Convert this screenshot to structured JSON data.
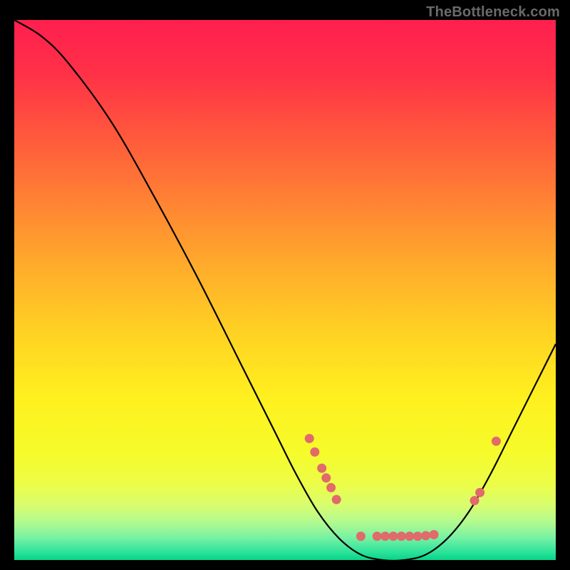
{
  "watermark": "TheBottleneck.com",
  "chart_data": {
    "type": "line",
    "title": "",
    "xlabel": "",
    "ylabel": "",
    "xlim": [
      0,
      100
    ],
    "ylim": [
      0,
      100
    ],
    "curve": [
      {
        "x": 0,
        "y": 100
      },
      {
        "x": 5,
        "y": 97
      },
      {
        "x": 10,
        "y": 92
      },
      {
        "x": 18,
        "y": 81
      },
      {
        "x": 26,
        "y": 67
      },
      {
        "x": 34,
        "y": 52
      },
      {
        "x": 42,
        "y": 36
      },
      {
        "x": 48,
        "y": 24
      },
      {
        "x": 52,
        "y": 16
      },
      {
        "x": 56,
        "y": 9
      },
      {
        "x": 60,
        "y": 4
      },
      {
        "x": 64,
        "y": 1
      },
      {
        "x": 68,
        "y": 0
      },
      {
        "x": 72,
        "y": 0
      },
      {
        "x": 76,
        "y": 1
      },
      {
        "x": 80,
        "y": 4
      },
      {
        "x": 84,
        "y": 9
      },
      {
        "x": 88,
        "y": 16
      },
      {
        "x": 92,
        "y": 24
      },
      {
        "x": 96,
        "y": 32
      },
      {
        "x": 100,
        "y": 40
      }
    ],
    "points": [
      {
        "x": 54.5,
        "y": 22.5
      },
      {
        "x": 55.5,
        "y": 20.0
      },
      {
        "x": 56.8,
        "y": 17.0
      },
      {
        "x": 57.6,
        "y": 15.2
      },
      {
        "x": 58.5,
        "y": 13.4
      },
      {
        "x": 59.5,
        "y": 11.2
      },
      {
        "x": 64.0,
        "y": 4.4
      },
      {
        "x": 67.0,
        "y": 4.4
      },
      {
        "x": 68.5,
        "y": 4.4
      },
      {
        "x": 70.0,
        "y": 4.4
      },
      {
        "x": 71.5,
        "y": 4.4
      },
      {
        "x": 73.0,
        "y": 4.4
      },
      {
        "x": 74.5,
        "y": 4.4
      },
      {
        "x": 76.0,
        "y": 4.5
      },
      {
        "x": 77.5,
        "y": 4.7
      },
      {
        "x": 85.0,
        "y": 11.0
      },
      {
        "x": 86.0,
        "y": 12.5
      },
      {
        "x": 89.0,
        "y": 22.0
      }
    ],
    "point_color": "#e16a6a",
    "point_radius": 6.5,
    "curve_color": "#000000",
    "gradient_stops": [
      {
        "offset": 0.0,
        "color": "#ff1f4f"
      },
      {
        "offset": 0.1,
        "color": "#ff3147"
      },
      {
        "offset": 0.22,
        "color": "#ff5a3c"
      },
      {
        "offset": 0.34,
        "color": "#ff8433"
      },
      {
        "offset": 0.46,
        "color": "#ffad2b"
      },
      {
        "offset": 0.58,
        "color": "#ffd223"
      },
      {
        "offset": 0.7,
        "color": "#fff01f"
      },
      {
        "offset": 0.8,
        "color": "#f6fb2a"
      },
      {
        "offset": 0.86,
        "color": "#ecfd48"
      },
      {
        "offset": 0.9,
        "color": "#d7fd70"
      },
      {
        "offset": 0.93,
        "color": "#b2fa90"
      },
      {
        "offset": 0.96,
        "color": "#74f1a3"
      },
      {
        "offset": 0.985,
        "color": "#2de39a"
      },
      {
        "offset": 1.0,
        "color": "#06d489"
      }
    ]
  }
}
